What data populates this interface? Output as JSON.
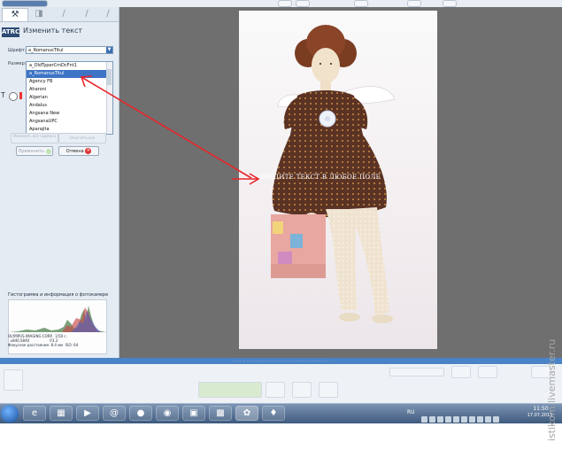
{
  "left_panel": {
    "panel_title": "Изменить текст",
    "logo_text": "ATRC",
    "font_label": "Шрифт:",
    "size_label": "Размер:",
    "font_select_value": "a_RomanusTitul",
    "font_options": [
      "a_OldTyperCmDcFnt1",
      "a_RomanusTitul",
      "Agency FB",
      "Aharoni",
      "Algerian",
      "Andalus",
      "Angsana New",
      "AngsanaUPC",
      "Aparajita"
    ],
    "selected_font_index": 1,
    "dim_buttons": [
      "Изменить все надписи",
      "Очистить все"
    ],
    "apply_label": "Применить",
    "cancel_label": "Отмена"
  },
  "histogram": {
    "title": "Гистограмма и информация о фотокамере",
    "camera": "OLYMPUS IMAGING CORP.",
    "model": "u840,S840",
    "shutter": "1/50 с.",
    "aperture": "f/3.3",
    "focal": "Фокусное расстояние: 8.4 мм",
    "iso": "ISO: 64"
  },
  "photo": {
    "overlay_text": "ВВЕДИТЕ ТЕКСТ В ЛЮБОЕ ПОЛЕ"
  },
  "taskbar": {
    "lang": "RU",
    "time": "11:50",
    "date": "17.07.2013"
  },
  "watermark": "istikom.livemaster.ru",
  "colors": {
    "workspace_bg": "#6f6f6f",
    "status_bar": "#4a83c6",
    "arrow": "#e8262b",
    "selected_item": "#3d74c5"
  }
}
